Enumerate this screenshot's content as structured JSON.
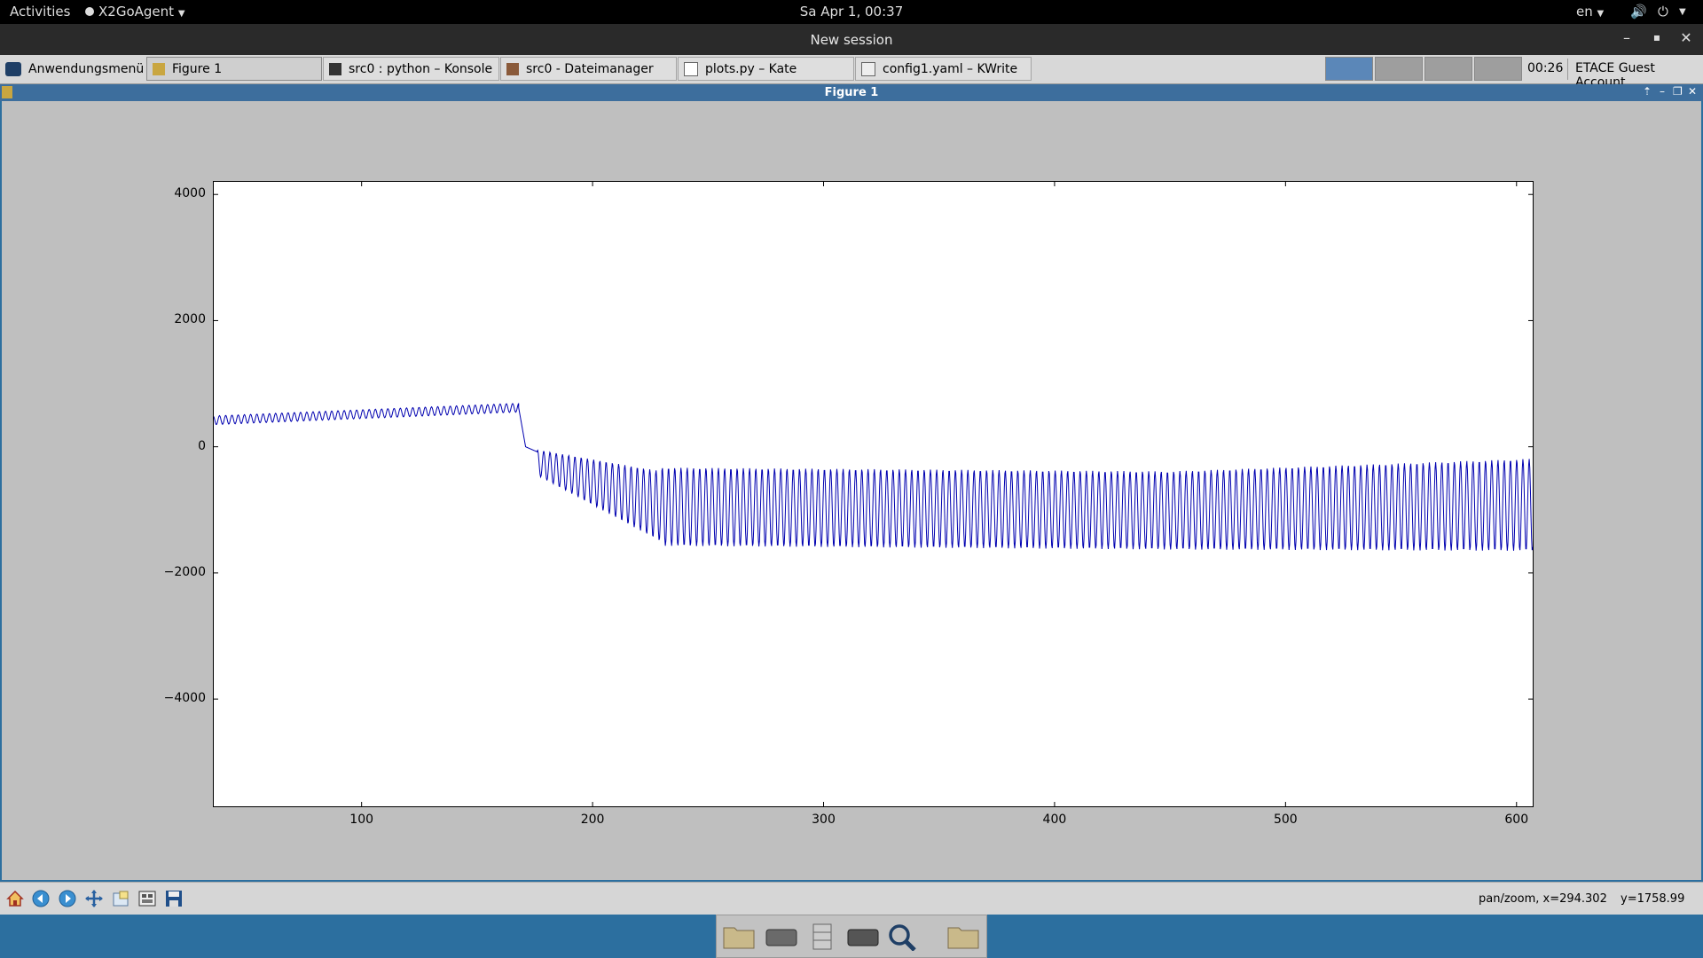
{
  "topbar": {
    "activities": "Activities",
    "app_menu": "X2GoAgent",
    "clock": "Sa Apr  1, 00:37",
    "language": "en"
  },
  "session": {
    "title": "New session"
  },
  "taskbar": {
    "app_menu": "Anwendungsmenü",
    "tasks": [
      {
        "label": "Figure 1"
      },
      {
        "label": "src0 : python – Konsole"
      },
      {
        "label": "src0 - Dateimanager"
      },
      {
        "label": "plots.py – Kate"
      },
      {
        "label": "config1.yaml – KWrite"
      }
    ],
    "clock": "00:26",
    "user": "ETACE Guest Account"
  },
  "figure": {
    "title": "Figure 1"
  },
  "status": {
    "mode_x": "pan/zoom, x=294.302",
    "y": "y=1758.99"
  },
  "chart_data": {
    "type": "line",
    "title": "",
    "xlabel": "",
    "ylabel": "",
    "xlim": [
      36,
      607
    ],
    "ylim": [
      -5700,
      4200
    ],
    "x_ticks": [
      100,
      200,
      300,
      400,
      500,
      600
    ],
    "y_ticks": [
      4000,
      2000,
      0,
      -2000,
      -4000
    ],
    "x_tick_labels": [
      "100",
      "200",
      "300",
      "400",
      "500",
      "600"
    ],
    "y_tick_labels": [
      "4000",
      "2000",
      "0",
      "−2000",
      "−4000"
    ],
    "grid": false,
    "color": "#0000b0",
    "segments": [
      {
        "x_start": 36,
        "x_end": 168,
        "mean_start": 420,
        "mean_end": 620,
        "amplitude": 70,
        "period": 2.7
      },
      {
        "x_start": 168,
        "x_end": 171,
        "mean_start": 620,
        "mean_end": 0,
        "amplitude": 0,
        "period": 1
      },
      {
        "x_start": 171,
        "x_end": 176,
        "mean_start": 0,
        "mean_end": -80,
        "amplitude": 0,
        "period": 1
      },
      {
        "x_start": 176,
        "x_end": 230,
        "mean_start": -250,
        "mean_end": -950,
        "amplitude_start": 200,
        "amplitude_end": 560,
        "period": 2.7
      },
      {
        "x_start": 230,
        "x_end": 450,
        "mean_start": -950,
        "mean_end": -1010,
        "amplitude": 620,
        "period": 2.7
      },
      {
        "x_start": 450,
        "x_end": 607,
        "mean_start": -1010,
        "mean_end": -920,
        "amplitude_start": 620,
        "amplitude_end": 730,
        "period": 2.7
      }
    ]
  }
}
